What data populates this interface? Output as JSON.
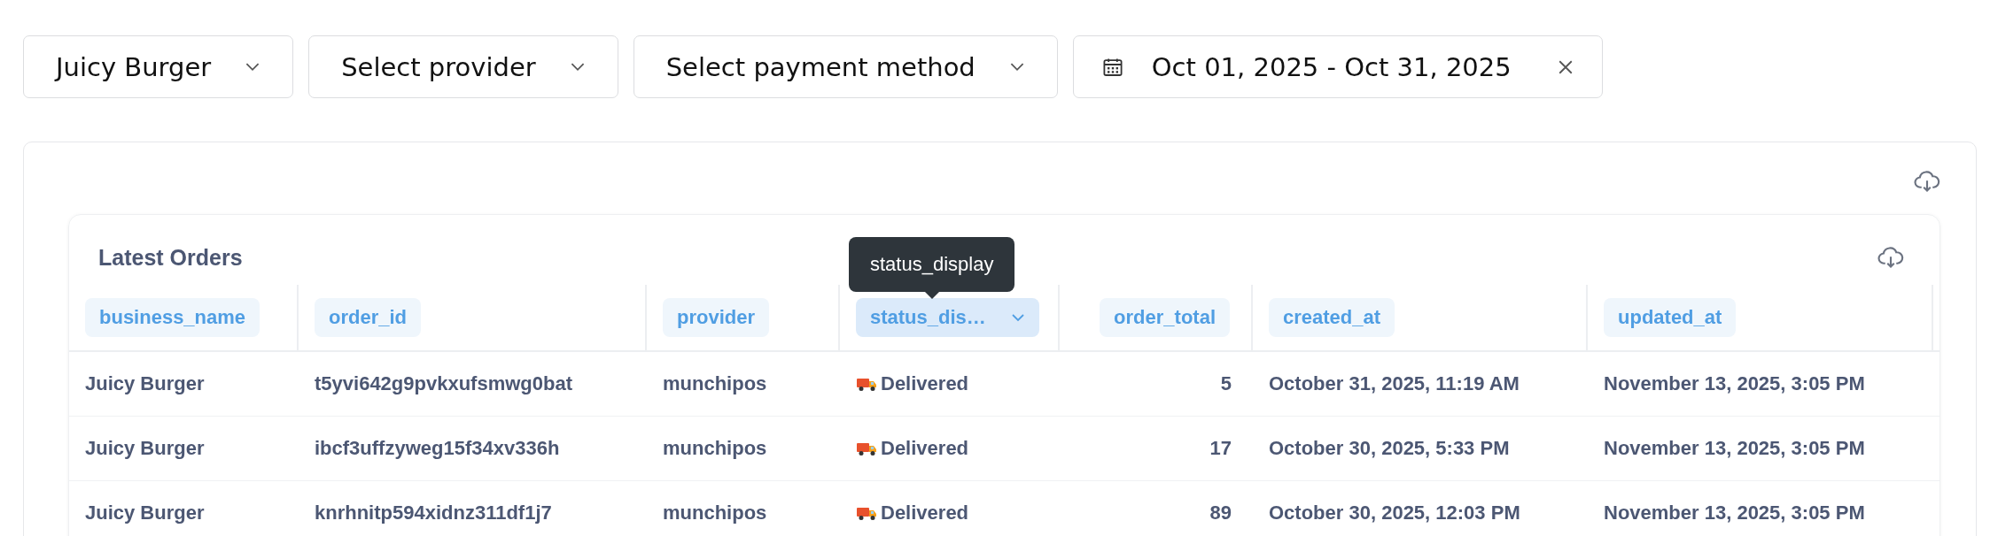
{
  "filters": [
    {
      "kind": "select",
      "label": "Juicy Burger"
    },
    {
      "kind": "select",
      "label": "Select provider"
    },
    {
      "kind": "select",
      "label": "Select payment method"
    },
    {
      "kind": "date_range",
      "label": "Oct 01, 2025 - Oct 31, 2025"
    }
  ],
  "card": {
    "title": "Latest Orders",
    "table": {
      "columns": [
        {
          "label": "business_name",
          "selected": false,
          "kind": "text"
        },
        {
          "label": "order_id",
          "selected": false,
          "kind": "text"
        },
        {
          "label": "provider",
          "selected": false,
          "kind": "text"
        },
        {
          "label": "status_dis…",
          "selected": true,
          "kind": "status",
          "tooltip": "status_display"
        },
        {
          "label": "order_total",
          "selected": false,
          "kind": "number"
        },
        {
          "label": "created_at",
          "selected": false,
          "kind": "text"
        },
        {
          "label": "updated_at",
          "selected": false,
          "kind": "text"
        }
      ],
      "rows": [
        {
          "cells": [
            "Juicy Burger",
            "t5yvi642g9pvkxufsmwg0bat",
            "munchipos",
            "Delivered",
            "5",
            "October 31, 2025, 11:19 AM",
            "November 13, 2025, 3:05 PM"
          ]
        },
        {
          "cells": [
            "Juicy Burger",
            "ibcf3uffzyweg15f34xv336h",
            "munchipos",
            "Delivered",
            "17",
            "October 30, 2025, 5:33 PM",
            "November 13, 2025, 3:05 PM"
          ]
        },
        {
          "cells": [
            "Juicy Burger",
            "knrhnitp594xidnz311df1j7",
            "munchipos",
            "Delivered",
            "89",
            "October 30, 2025, 12:03 PM",
            "November 13, 2025, 3:05 PM"
          ]
        }
      ]
    }
  }
}
